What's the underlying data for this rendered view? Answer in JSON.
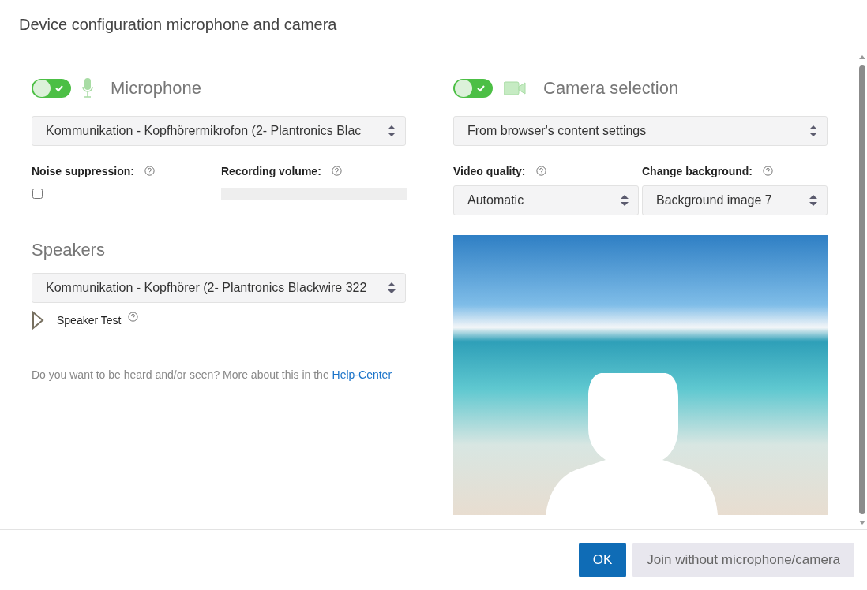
{
  "dialog": {
    "title": "Device configuration microphone and camera"
  },
  "microphone": {
    "enabled": true,
    "heading": "Microphone",
    "device": "Kommunikation - Kopfhörermikrofon (2- Plantronics Blac",
    "noise_label": "Noise suppression:",
    "noise_checked": false,
    "volume": {
      "label": "Recording volume:",
      "level": 0
    }
  },
  "speakers": {
    "heading": "Speakers",
    "device": "Kommunikation - Kopfhörer (2- Plantronics Blackwire 322",
    "test_label": "Speaker Test"
  },
  "help": {
    "text": "Do you want to be heard and/or seen? More about this in the ",
    "link": "Help-Center"
  },
  "camera": {
    "enabled": true,
    "heading": "Camera selection",
    "device": "From browser's content settings",
    "quality_label": "Video quality:",
    "quality": "Automatic",
    "background_label": "Change background:",
    "background": "Background image 7"
  },
  "buttons": [
    {
      "label": "OK",
      "kind": "primary"
    },
    {
      "label": "Join without microphone/camera",
      "kind": "secondary"
    }
  ]
}
